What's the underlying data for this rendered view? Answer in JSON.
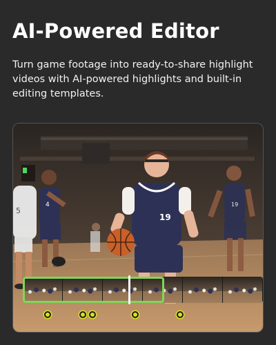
{
  "header": {
    "title": "AI-Powered Editor",
    "description": "Turn game footage into ready-to-share highlight videos with AI-powered highlights and built-in editing templates."
  },
  "video": {
    "players": [
      {
        "jersey": "19",
        "color": "#2d3155"
      },
      {
        "jersey": "4",
        "color": "#2d3155"
      },
      {
        "jersey": "5",
        "color": "#f0f0f0"
      },
      {
        "jersey": "19",
        "color": "#2d3155"
      }
    ],
    "timeline": {
      "selected_fraction": 0.59,
      "playhead_fraction": 0.44,
      "highlight_color": "#7fd75a",
      "marker_color": "#d9e021"
    }
  },
  "colors": {
    "background": "#2a2a2a",
    "text": "#ffffff",
    "accent": "#7fd75a"
  }
}
